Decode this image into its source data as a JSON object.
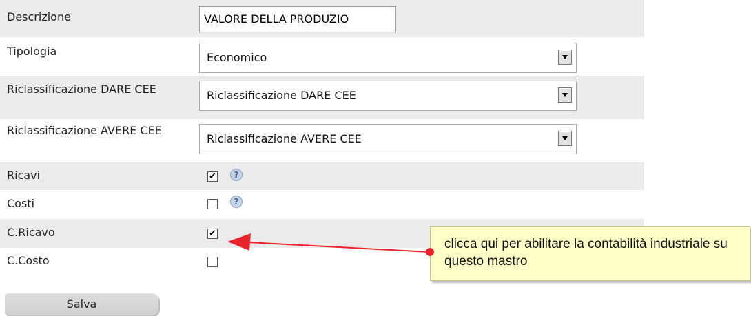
{
  "form": {
    "descrizione": {
      "label": "Descrizione",
      "value": "VALORE DELLA PRODUZIO"
    },
    "tipologia": {
      "label": "Tipologia",
      "value": "Economico"
    },
    "riclass_dare": {
      "label": "Riclassificazione DARE CEE",
      "value": "Riclassificazione DARE CEE"
    },
    "riclass_avere": {
      "label": "Riclassificazione AVERE CEE",
      "value": "Riclassificazione AVERE CEE"
    },
    "ricavi": {
      "label": "Ricavi",
      "checked": true
    },
    "costi": {
      "label": "Costi",
      "checked": false
    },
    "c_ricavo": {
      "label": "C.Ricavo",
      "checked": true
    },
    "c_costo": {
      "label": "C.Costo",
      "checked": false
    },
    "help_symbol": "?",
    "check_symbol": "✔",
    "save_label": "Salva"
  },
  "callout": {
    "text": "clicca qui per abilitare la contabilità industriale su questo mastro"
  },
  "colors": {
    "row_alt": "#ebebeb",
    "callout_bg": "#ffffc7",
    "arrow": "#e8232a"
  }
}
